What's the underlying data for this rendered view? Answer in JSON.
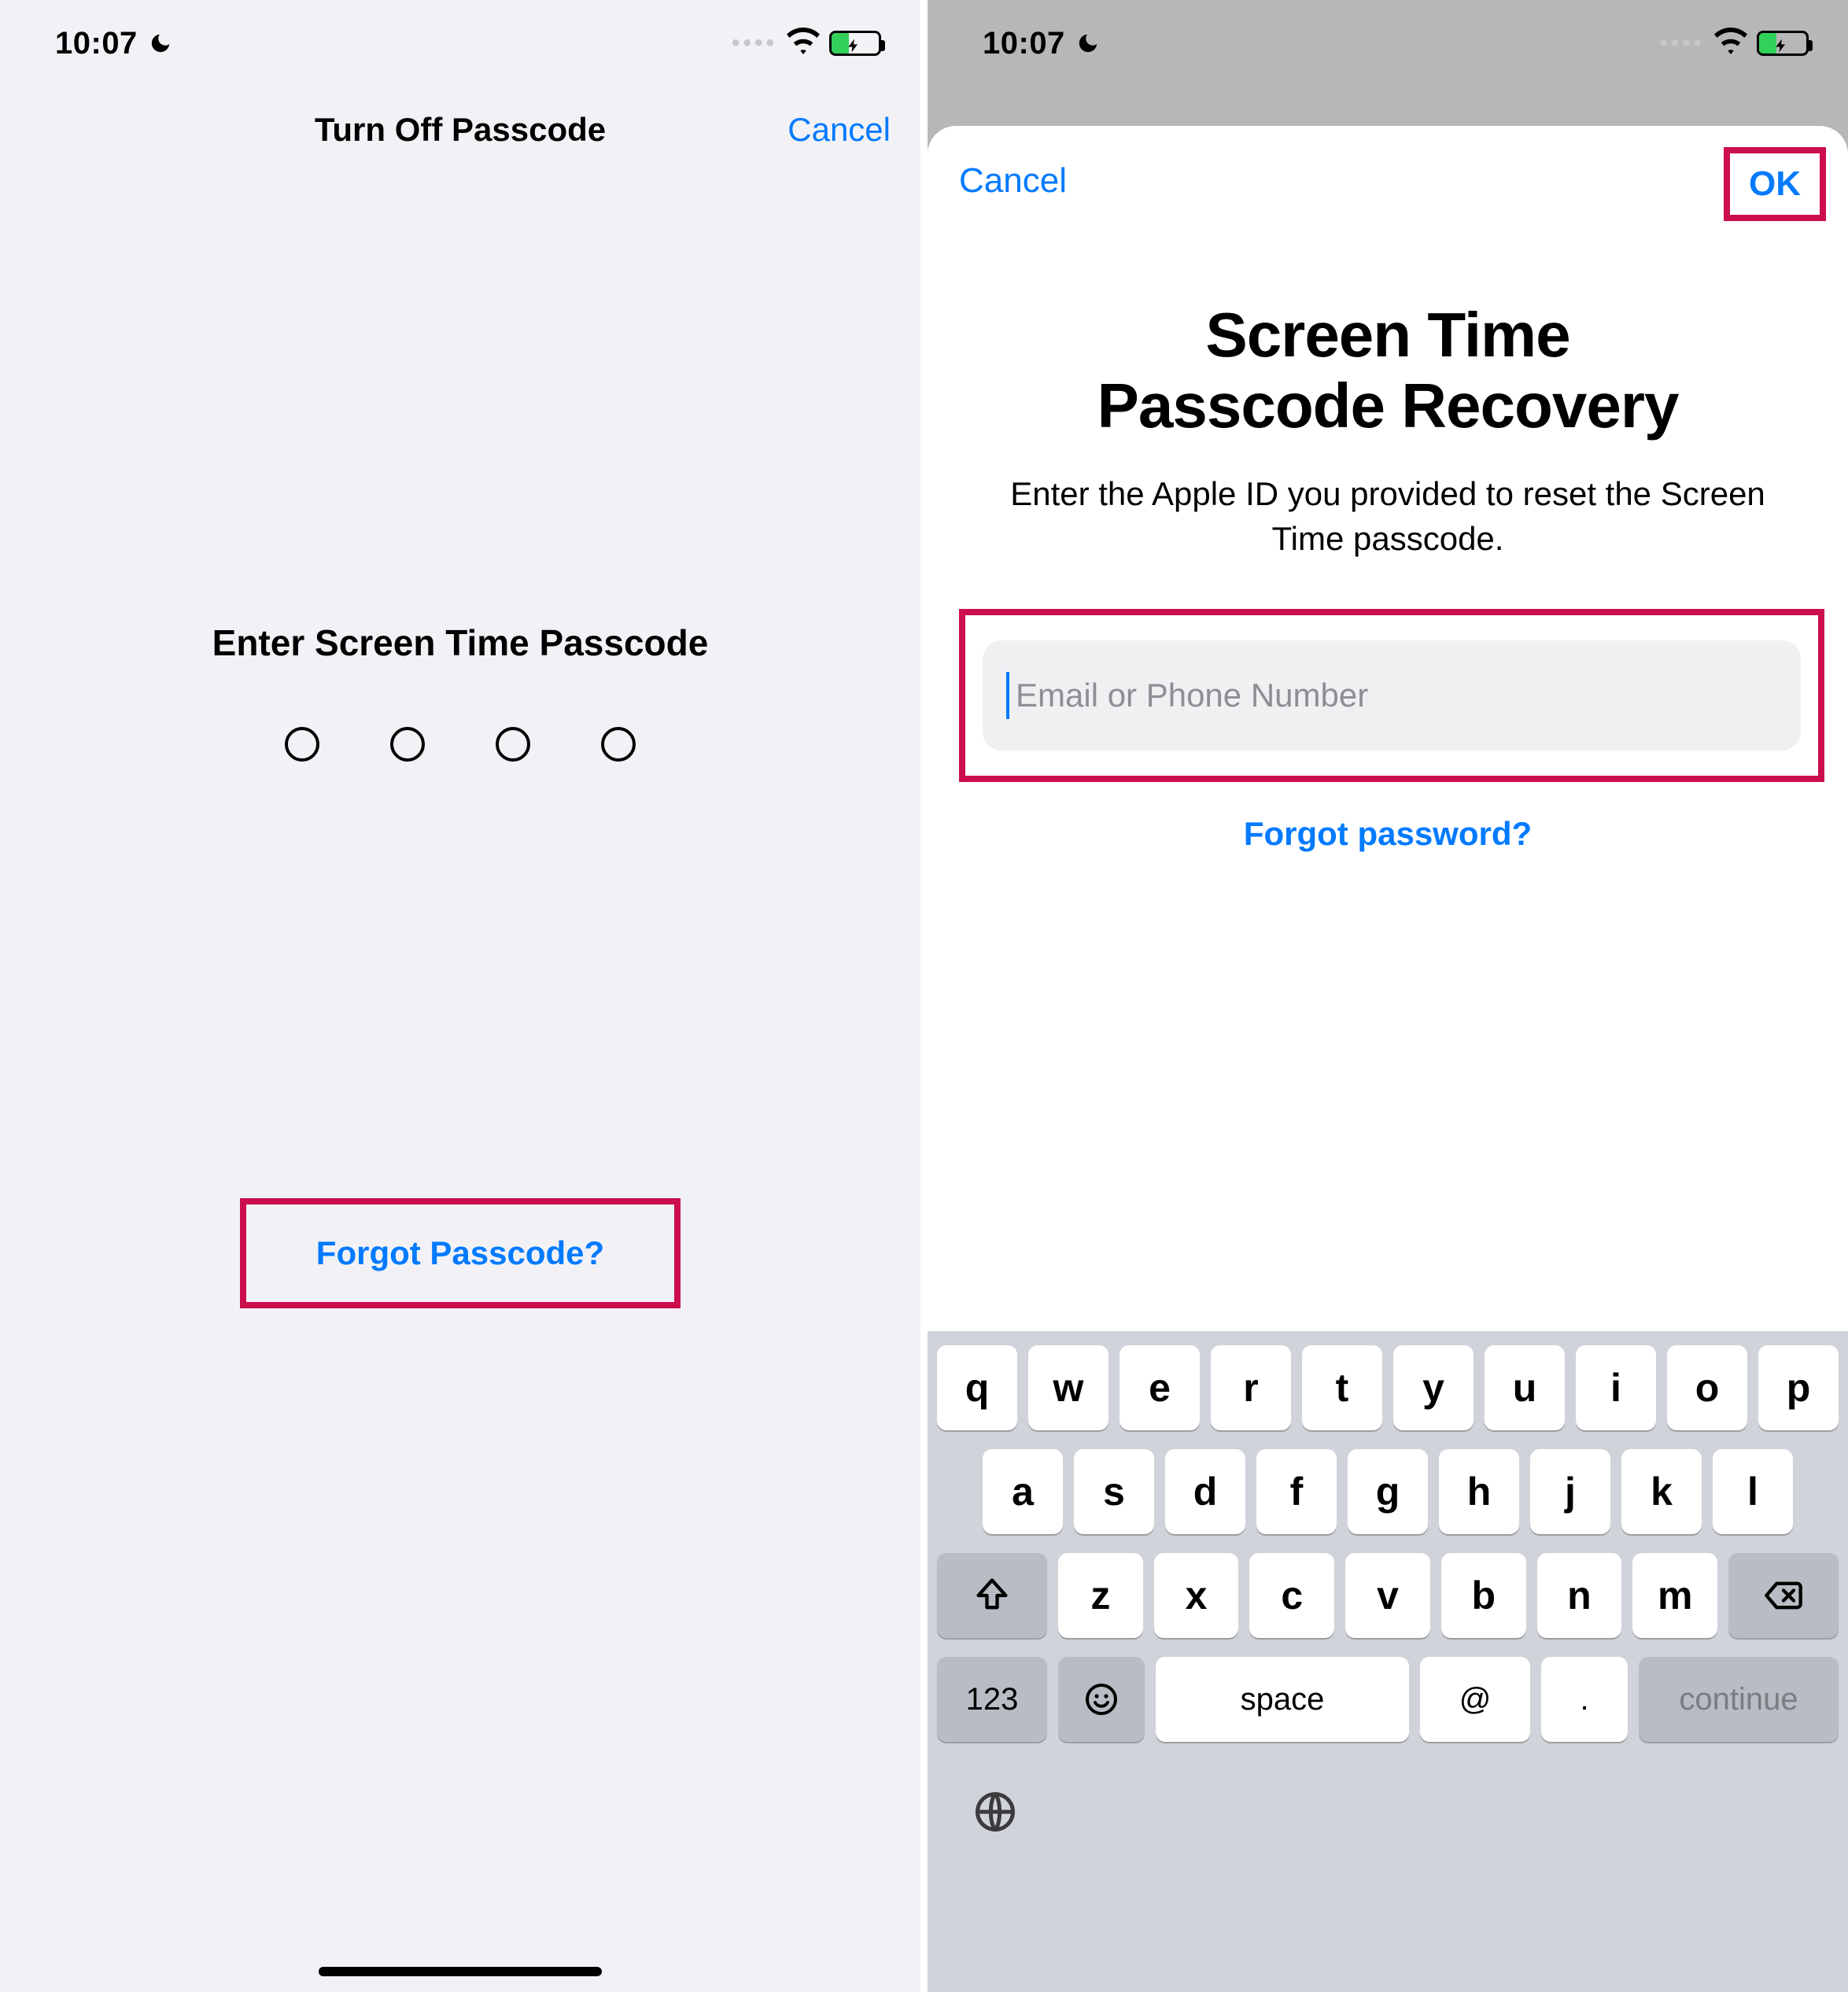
{
  "status": {
    "time": "10:07"
  },
  "left": {
    "title": "Turn Off Passcode",
    "cancel": "Cancel",
    "prompt": "Enter Screen Time Passcode",
    "forgot": "Forgot Passcode?"
  },
  "right": {
    "cancel": "Cancel",
    "ok": "OK",
    "title_l1": "Screen Time",
    "title_l2": "Passcode Recovery",
    "subtitle": "Enter the Apple ID you provided to reset the Screen Time passcode.",
    "placeholder": "Email or Phone Number",
    "forgot_pw": "Forgot password?"
  },
  "keyboard": {
    "r1": [
      "q",
      "w",
      "e",
      "r",
      "t",
      "y",
      "u",
      "i",
      "o",
      "p"
    ],
    "r2": [
      "a",
      "s",
      "d",
      "f",
      "g",
      "h",
      "j",
      "k",
      "l"
    ],
    "r3": [
      "z",
      "x",
      "c",
      "v",
      "b",
      "n",
      "m"
    ],
    "numKey": "123",
    "space": "space",
    "at": "@",
    "dot": ".",
    "cont": "continue"
  }
}
